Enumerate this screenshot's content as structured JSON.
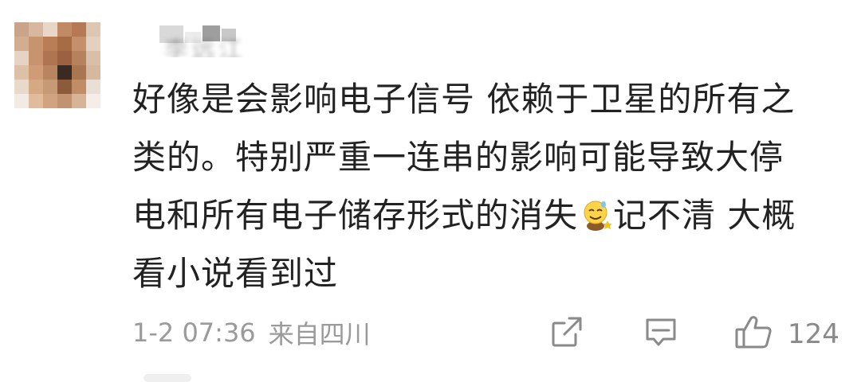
{
  "comment": {
    "username": "李远江",
    "lines": [
      "好像是会影响电子信号 依赖于卫星的所有之",
      "类的。特别严重一连串的影响可能导致大停",
      "电和所有电子储存形式的消失",
      "记不清 大概",
      "看小说看到过"
    ],
    "emoji": "sweat-smile-emoji-icon",
    "time": "1-2 07:36",
    "location": "来自四川",
    "like_count": "124"
  },
  "icons": {
    "share": "share-icon",
    "reply": "reply-icon",
    "like": "thumbs-up-icon"
  },
  "colors": {
    "text": "#222222",
    "meta": "#9a9a9a",
    "icon": "#8a8a8a",
    "background": "#ffffff"
  }
}
